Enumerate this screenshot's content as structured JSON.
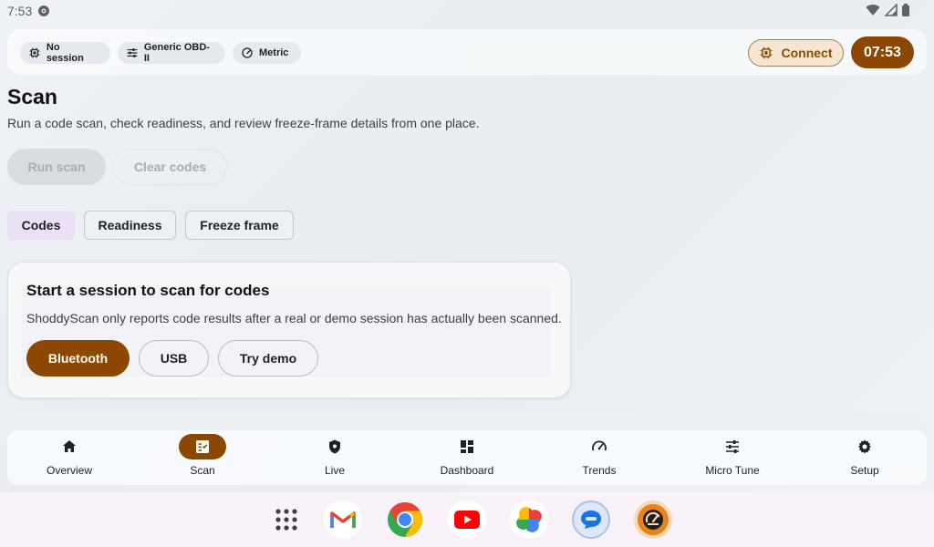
{
  "status_bar": {
    "time": "7:53"
  },
  "top_bar": {
    "chips": [
      {
        "label": "No session",
        "icon": "chip-icon"
      },
      {
        "label": "Generic OBD-II",
        "icon": "tune-icon"
      },
      {
        "label": "Metric",
        "icon": "speedometer-icon"
      }
    ],
    "connect_label": "Connect",
    "clock": "07:53"
  },
  "page": {
    "title": "Scan",
    "subtitle": "Run a code scan, check readiness, and review freeze-frame details from one place.",
    "run_scan_label": "Run scan",
    "clear_codes_label": "Clear codes"
  },
  "tabs": [
    {
      "label": "Codes",
      "selected": true
    },
    {
      "label": "Readiness",
      "selected": false
    },
    {
      "label": "Freeze frame",
      "selected": false
    }
  ],
  "card": {
    "title": "Start a session to scan for codes",
    "text": "ShoddyScan only reports code results after a real or demo session has actually been scanned.",
    "buttons": [
      "Bluetooth",
      "USB",
      "Try demo"
    ]
  },
  "bottom_nav": [
    {
      "label": "Overview",
      "icon": "home-icon",
      "active": false
    },
    {
      "label": "Scan",
      "icon": "scan-checklist-icon",
      "active": true
    },
    {
      "label": "Live",
      "icon": "shield-icon",
      "active": false
    },
    {
      "label": "Dashboard",
      "icon": "dashboard-icon",
      "active": false
    },
    {
      "label": "Trends",
      "icon": "speedometer-icon",
      "active": false
    },
    {
      "label": "Micro Tune",
      "icon": "sliders-icon",
      "active": false
    },
    {
      "label": "Setup",
      "icon": "gear-icon",
      "active": false
    }
  ],
  "dock_apps": [
    "app-drawer",
    "gmail",
    "chrome",
    "youtube",
    "photos",
    "messages",
    "shoddyscan"
  ],
  "colors": {
    "accent": "#8c4800",
    "accent_light": "#f4e6d3",
    "tab_selected": "#ebe0f4",
    "dock_background": "#f9f3f9"
  }
}
